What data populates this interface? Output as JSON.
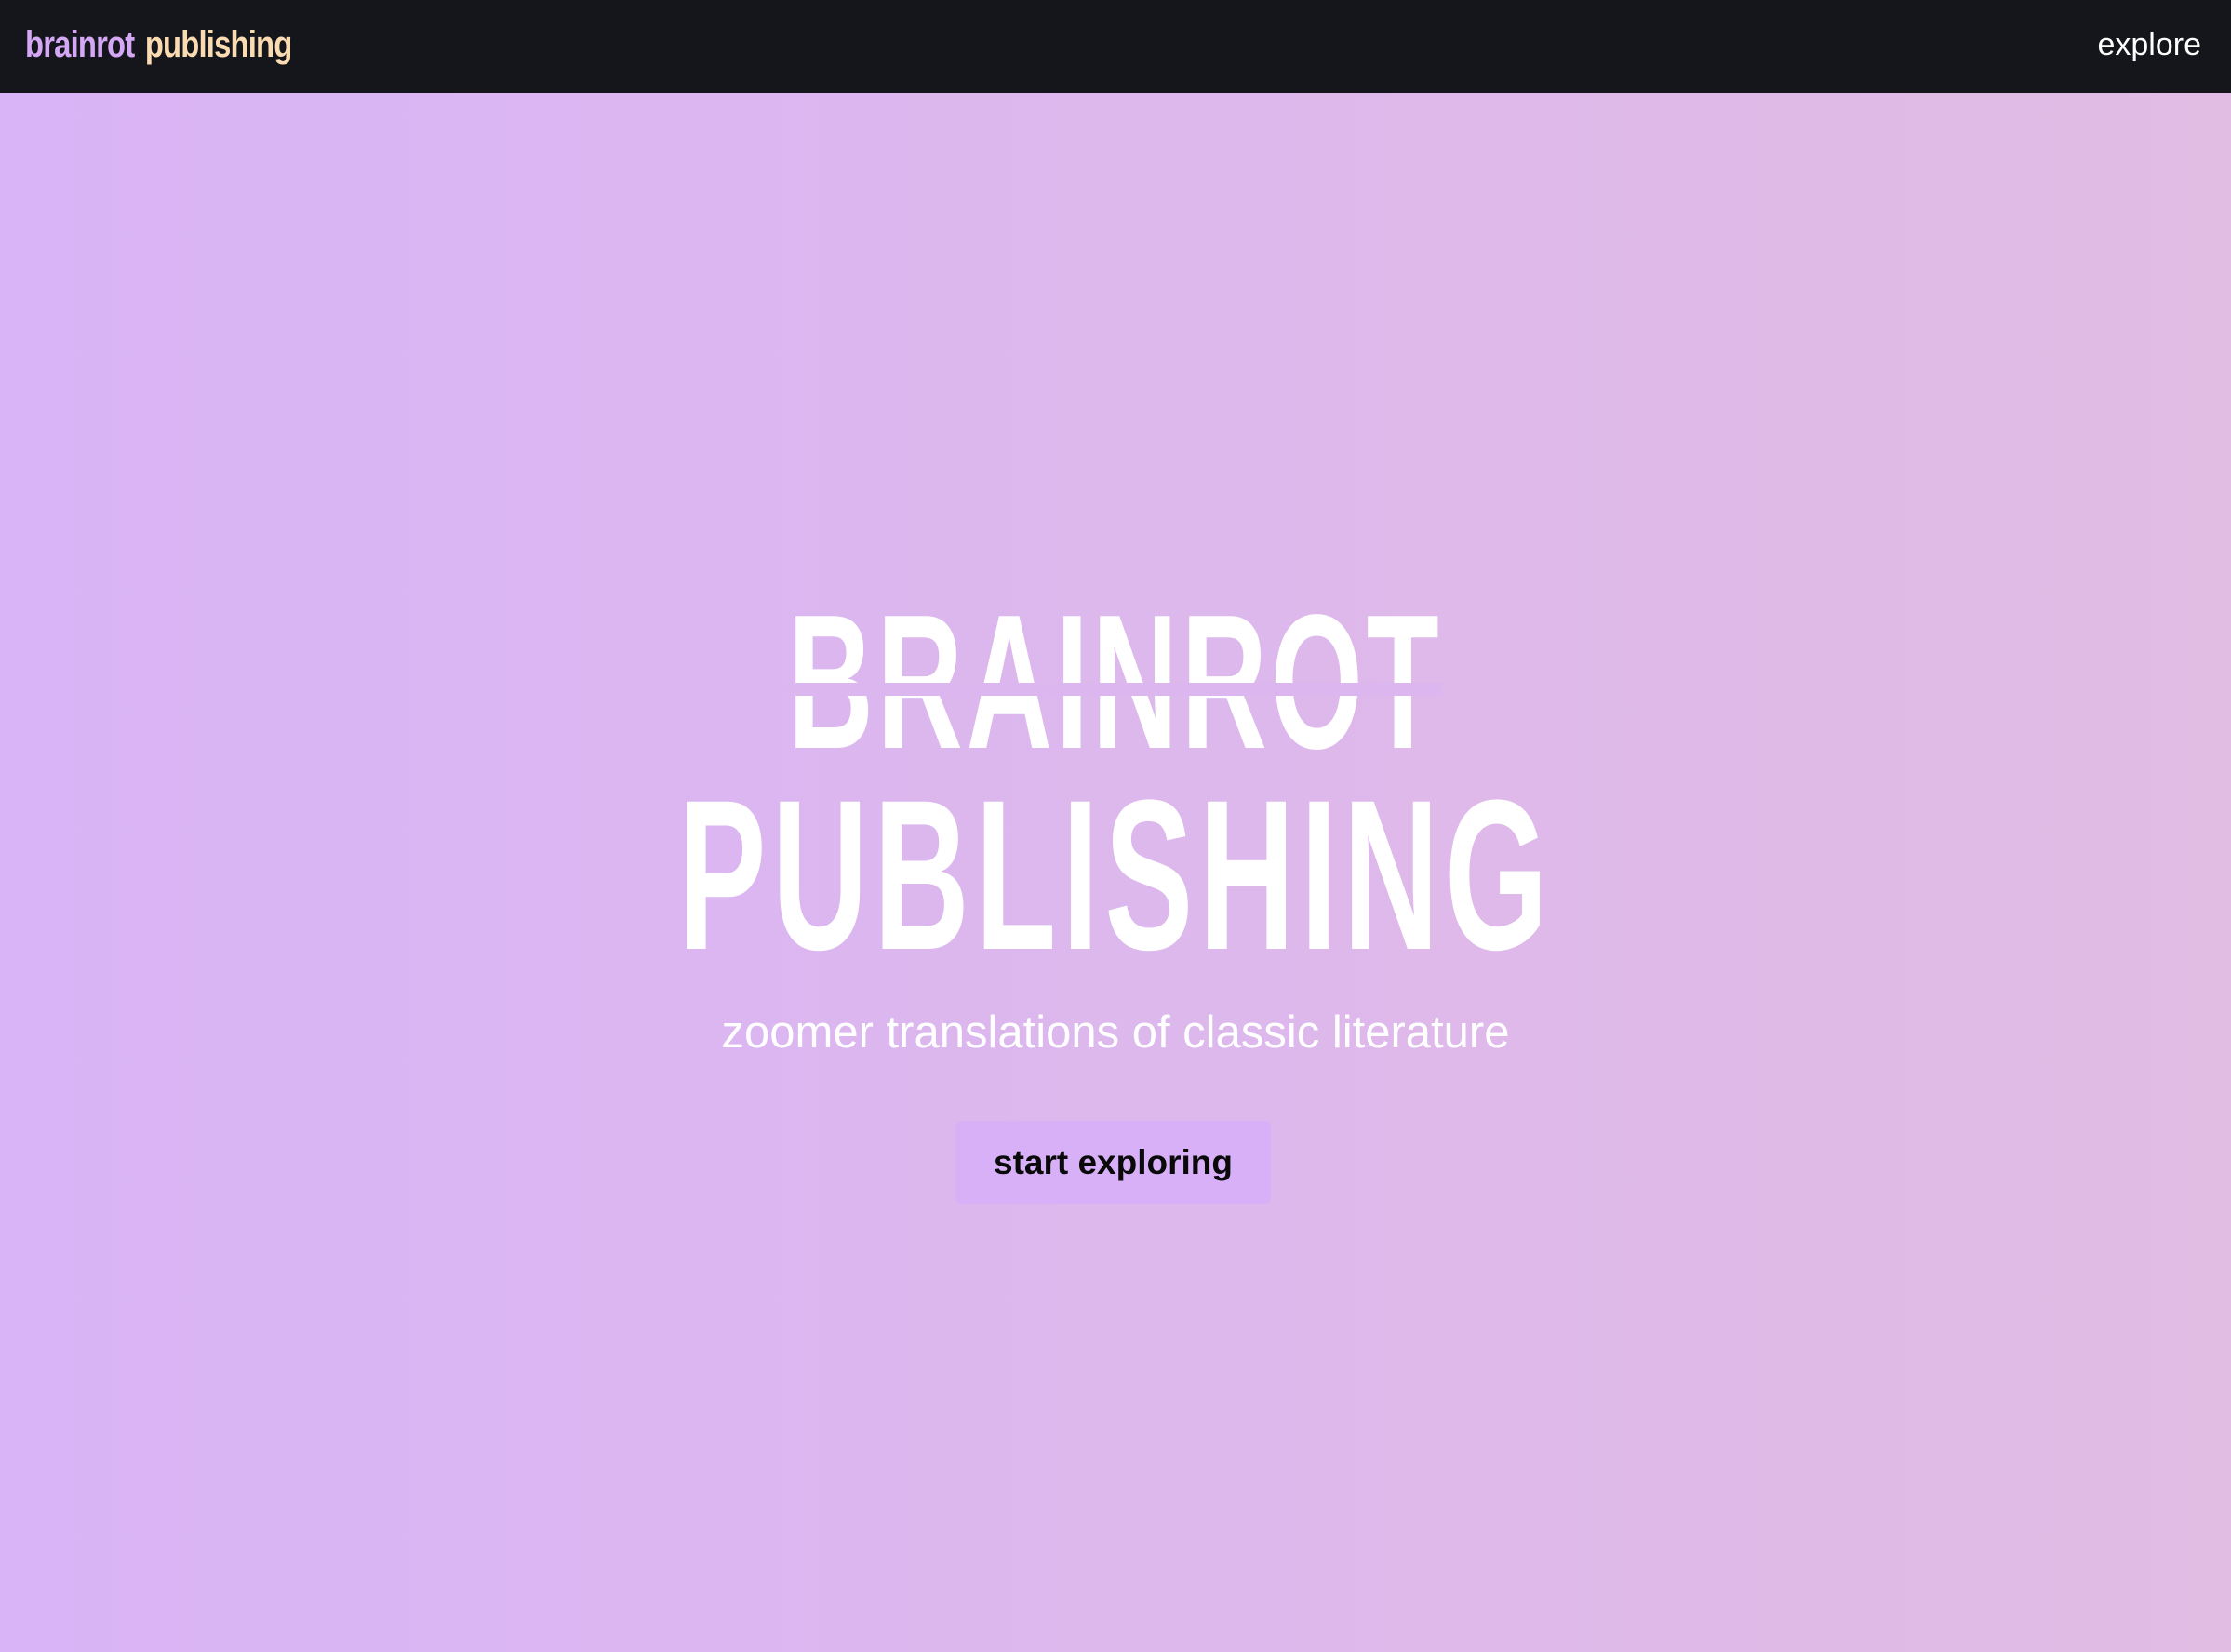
{
  "navbar": {
    "brand_word_1": "brainrot",
    "brand_word_2": "publishing",
    "nav_link": "explore"
  },
  "hero": {
    "title_line_1": "BRAINROT",
    "title_line_2": "PUBLISHING",
    "tagline": "zoomer translations of classic literature",
    "cta_label": "start exploring"
  },
  "colors": {
    "navbar_bg": "#15161c",
    "brand_word_1": "#d4a8f5",
    "brand_word_2": "#fbdcb2",
    "hero_bg_start": "#d9b4f6",
    "hero_bg_end": "#e1bce3",
    "cta_bg": "#d7b0f7",
    "hero_text": "#ffffff"
  }
}
